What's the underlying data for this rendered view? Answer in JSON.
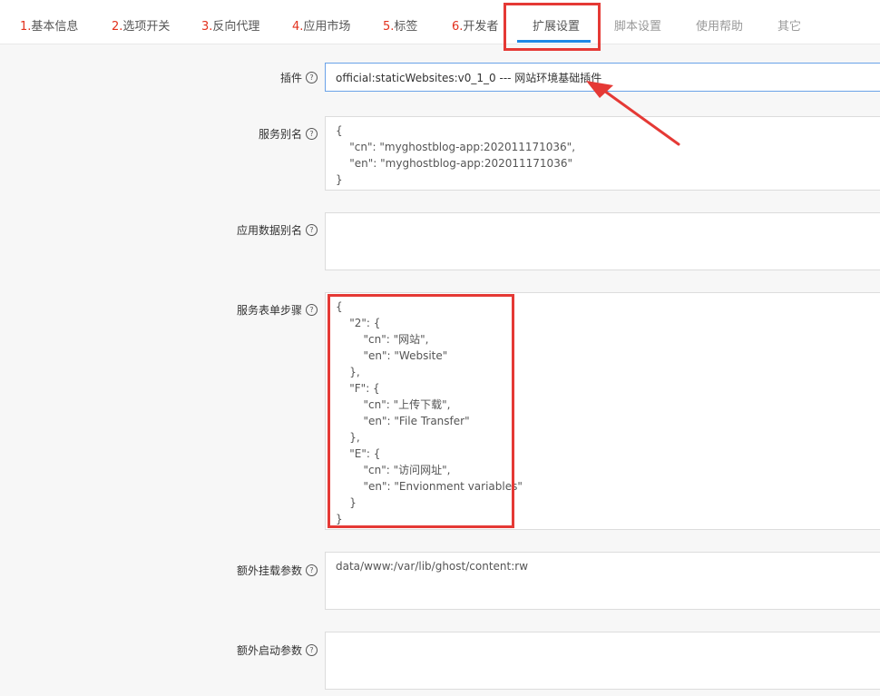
{
  "tabs": [
    {
      "num": "1.",
      "label": "基本信息"
    },
    {
      "num": "2.",
      "label": "选项开关"
    },
    {
      "num": "3.",
      "label": "反向代理"
    },
    {
      "num": "4.",
      "label": "应用市场"
    },
    {
      "num": "5.",
      "label": "标签"
    },
    {
      "num": "6.",
      "label": "开发者"
    },
    {
      "num": "",
      "label": "扩展设置"
    },
    {
      "num": "",
      "label": "脚本设置"
    },
    {
      "num": "",
      "label": "使用帮助"
    },
    {
      "num": "",
      "label": "其它"
    }
  ],
  "help_glyph": "?",
  "fields": {
    "plugin": {
      "label": "插件",
      "value": "official:staticWebsites:v0_1_0 --- 网站环境基础插件"
    },
    "service_alias": {
      "label": "服务别名",
      "value": "{\n    \"cn\": \"myghostblog-app:202011171036\",\n    \"en\": \"myghostblog-app:202011171036\"\n}"
    },
    "app_data_alias": {
      "label": "应用数据别名",
      "value": ""
    },
    "form_steps": {
      "label": "服务表单步骤",
      "value": "{\n    \"2\": {\n        \"cn\": \"网站\",\n        \"en\": \"Website\"\n    },\n    \"F\": {\n        \"cn\": \"上传下载\",\n        \"en\": \"File Transfer\"\n    },\n    \"E\": {\n        \"cn\": \"访问网址\",\n        \"en\": \"Envionment variables\"\n    }\n}"
    },
    "extra_mounts": {
      "label": "额外挂载参数",
      "value": "data/www:/var/lib/ghost/content:rw"
    },
    "extra_start": {
      "label": "额外启动参数",
      "value": ""
    }
  },
  "colors": {
    "tab_number": "#e2311d",
    "active_underline": "#1e88e5",
    "annotation": "#e53935"
  }
}
